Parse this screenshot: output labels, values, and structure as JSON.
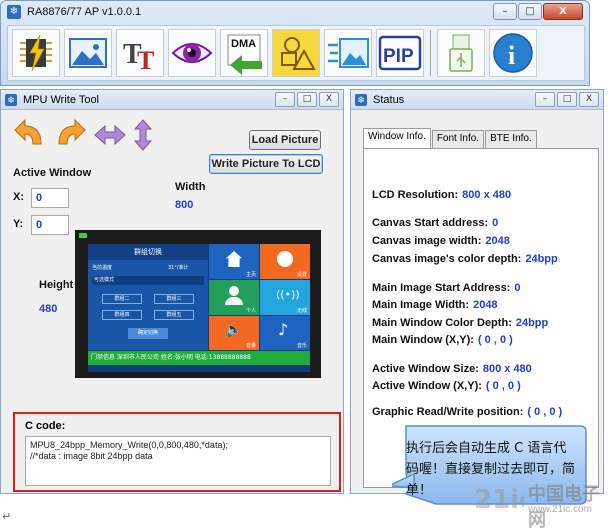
{
  "app": {
    "title": "RA8876/77 AP v1.0.0.1"
  },
  "window_buttons": {
    "minimize": "–",
    "restore": "□",
    "close": "X"
  },
  "toolbar": [
    {
      "name": "chip-tool-icon"
    },
    {
      "name": "image-tool-icon"
    },
    {
      "name": "text-tool-icon",
      "glyph": "TT"
    },
    {
      "name": "eye-tool-icon"
    },
    {
      "name": "dma-tool-icon",
      "glyph": "DMA"
    },
    {
      "name": "shapes-tool-icon"
    },
    {
      "name": "image-transfer-tool-icon"
    },
    {
      "name": "pip-tool-icon",
      "glyph": "PIP"
    },
    {
      "name": "usb-tool-icon"
    },
    {
      "name": "info-tool-icon",
      "glyph": "i"
    }
  ],
  "mpu": {
    "title": "MPU Write Tool",
    "load_picture": "Load Picture",
    "write_picture": "Write Picture To LCD",
    "active_window": "Active Window",
    "x_label": "X:",
    "x_value": "0",
    "y_label": "Y:",
    "y_value": "0",
    "width_label": "Width",
    "width_value": "800",
    "height_label": "Height",
    "height_value": "480",
    "code_label": "C code:",
    "code_line1": "MPU8_24bpp_Memory_Write(0,0,800,480,*data);",
    "code_line2": "//*data : image 8bit 24bpp data"
  },
  "preview": {
    "header": "群组切换",
    "row1_left": "当前温度",
    "row1_right": "31°/准计",
    "row2": "可选模式",
    "btn1": "群组二",
    "btn2": "群组三",
    "btn3": "群组四",
    "btn4": "群组五",
    "confirm": "确定切换",
    "tile1": "主页",
    "tile2": "设置",
    "tile3": "个人",
    "tile4": "无线",
    "tile5": "音量",
    "tile6": "音乐",
    "footer": "门禁信息 深圳市人民公司 姓名:张小明 电话:13888888888"
  },
  "status": {
    "title": "Status",
    "tabs": [
      "Window Info.",
      "Font Info.",
      "BTE Info."
    ],
    "rows": [
      {
        "label": "LCD Resolution:",
        "value": "800 x 480"
      },
      {
        "label": "Canvas Start address:",
        "value": "0"
      },
      {
        "label": "Canvas image width:",
        "value": "2048"
      },
      {
        "label": "Canvas image's color depth:",
        "value": "24bpp"
      },
      {
        "label": "Main Image Start Address:",
        "value": "0"
      },
      {
        "label": "Main Image Width:",
        "value": "2048"
      },
      {
        "label": "Main Window Color Depth:",
        "value": "24bpp"
      },
      {
        "label": "Main Window (X,Y):",
        "value": "( 0 , 0 )"
      },
      {
        "label": "Active Window Size:",
        "value": "800 x 480"
      },
      {
        "label": "Active Window (X,Y):",
        "value": "( 0 , 0 )"
      },
      {
        "label": "Graphic Read/Write position:",
        "value": "( 0 , 0 )"
      }
    ]
  },
  "callout": {
    "text": "执行后会自动生成 C 语言代码喔！直接复制过去即可，简单！"
  },
  "watermark": {
    "text": "中国电子网",
    "url": "www.21ic.com"
  },
  "colors": {
    "accent_blue": "#1f3fd1",
    "highlight_red": "#e01b1b",
    "title_bar": "#cfdcee"
  }
}
